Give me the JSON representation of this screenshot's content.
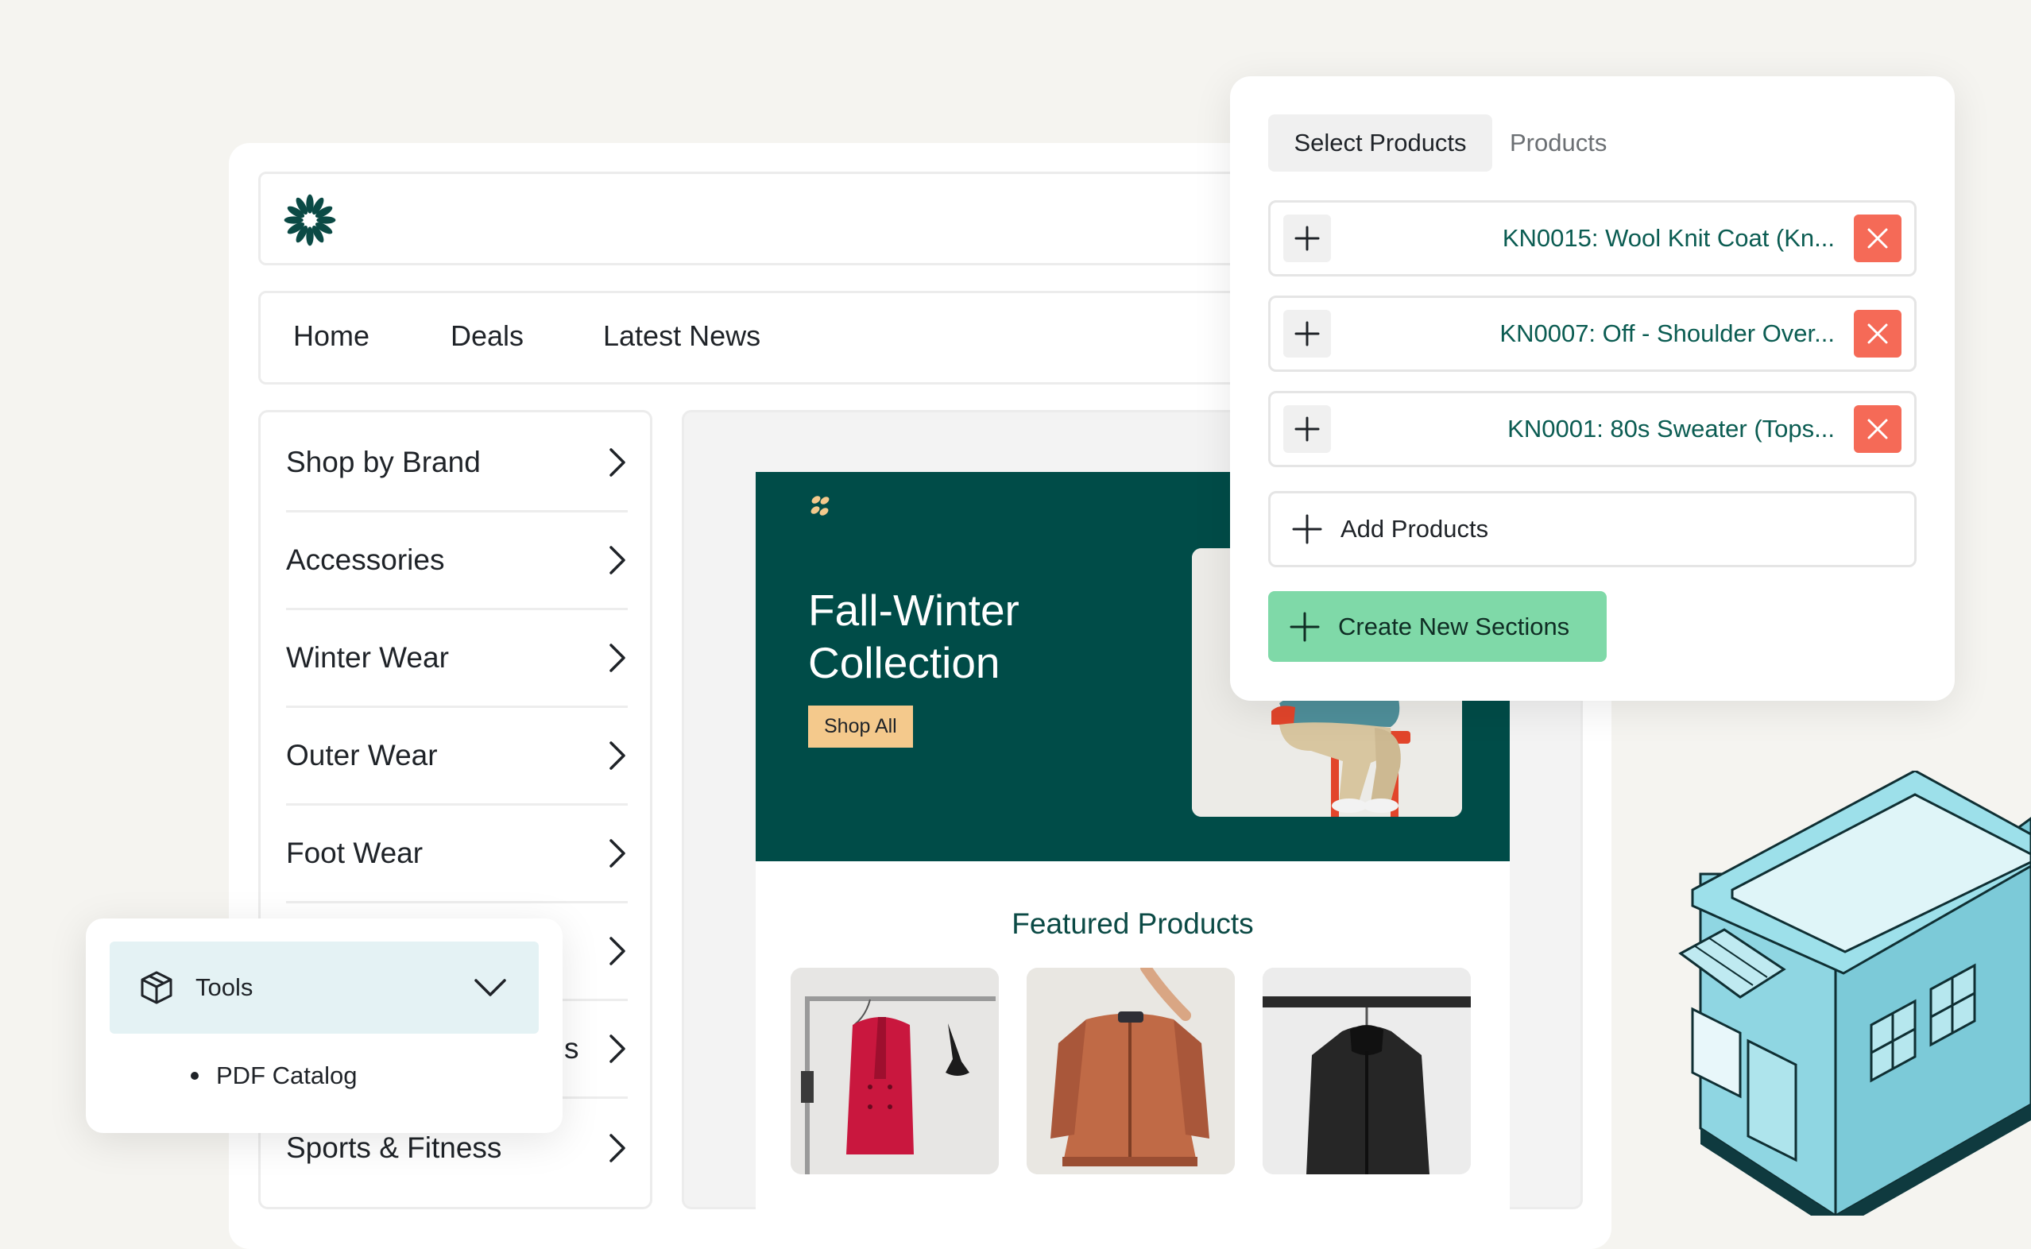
{
  "nav": {
    "items": [
      {
        "label": "Home"
      },
      {
        "label": "Deals"
      },
      {
        "label": "Latest News"
      }
    ]
  },
  "sidebar": {
    "items": [
      {
        "label": "Shop by Brand"
      },
      {
        "label": "Accessories"
      },
      {
        "label": "Winter Wear"
      },
      {
        "label": "Outer Wear"
      },
      {
        "label": "Foot Wear"
      },
      {
        "label": ""
      },
      {
        "label": "s"
      },
      {
        "label": "Sports & Fitness"
      }
    ]
  },
  "hero": {
    "title": "Fall-Winter Collection",
    "cta_label": "Shop All"
  },
  "featured": {
    "title": "Featured Products"
  },
  "panel": {
    "tabs": [
      {
        "label": "Select Products",
        "active": true
      },
      {
        "label": "Products",
        "active": false
      }
    ],
    "selected_products": [
      {
        "label": "KN0015: Wool Knit Coat (Kn..."
      },
      {
        "label": "KN0007: Off - Shoulder Over..."
      },
      {
        "label": "KN0001: 80s Sweater (Tops..."
      }
    ],
    "add_label": "Add Products",
    "create_label": "Create New Sections"
  },
  "tools": {
    "label": "Tools",
    "items": [
      {
        "label": "PDF Catalog"
      }
    ]
  },
  "colors": {
    "brand_dark_green": "#004c48",
    "accent_mint": "#7fd9a8",
    "remove_red": "#f56a57",
    "cta_tan": "#f4c98c",
    "product_text_green": "#0b5c52"
  },
  "icons": {
    "logo": "asterisk-flower-logo-icon",
    "hero_mark": "swirl-mark-icon",
    "add": "plus-icon",
    "remove": "close-icon",
    "chevron": "chevron-right-icon",
    "tools": "package-box-icon",
    "tools_toggle": "chevron-down-icon"
  }
}
